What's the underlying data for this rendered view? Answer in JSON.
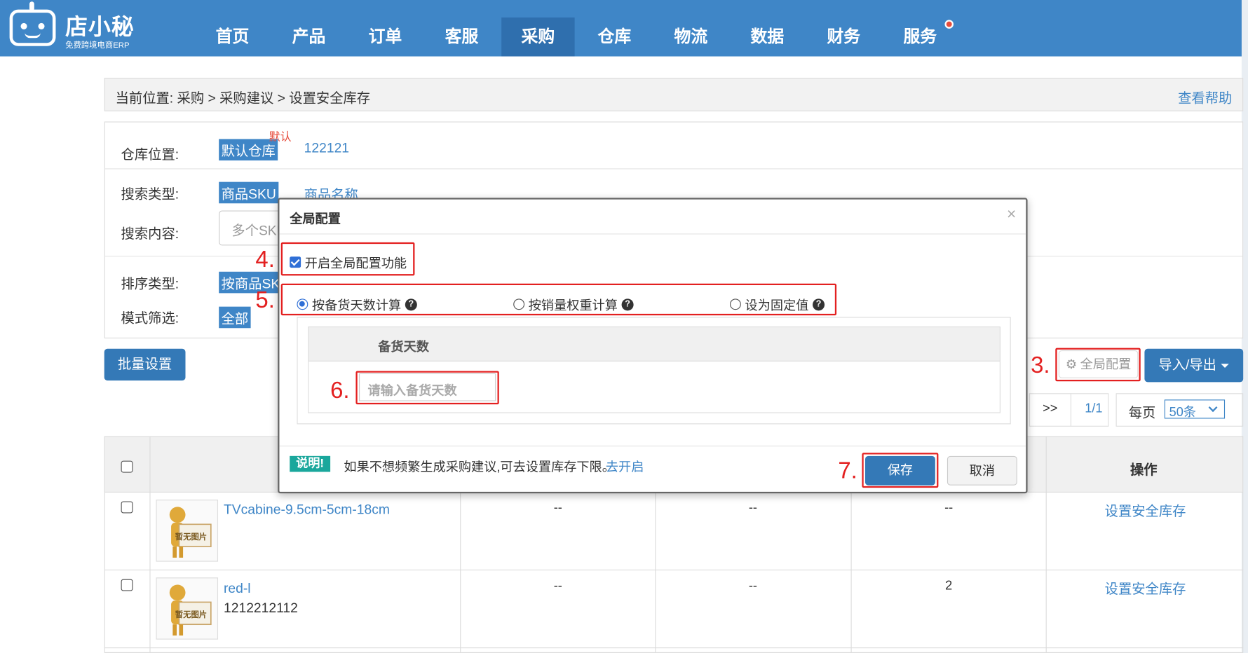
{
  "header": {
    "logo_name": "店小秘",
    "logo_sub": "免费跨境电商ERP",
    "nav": [
      {
        "label": "首页"
      },
      {
        "label": "产品"
      },
      {
        "label": "订单"
      },
      {
        "label": "客服"
      },
      {
        "label": "采购",
        "active": true
      },
      {
        "label": "仓库"
      },
      {
        "label": "物流"
      },
      {
        "label": "数据"
      },
      {
        "label": "财务"
      },
      {
        "label": "服务",
        "badge": true
      }
    ]
  },
  "breadcrumb": {
    "text": "当前位置: 采购 > 采购建议 > 设置安全库存",
    "help": "查看帮助"
  },
  "filters": {
    "warehouse_label": "仓库位置:",
    "warehouse_selected": "默认仓库",
    "warehouse_default_tag": "默认",
    "warehouse_other": "122121",
    "search_type_label": "搜索类型:",
    "search_type_selected": "商品SKU",
    "search_type_other": "商品名称",
    "search_content_label": "搜索内容:",
    "search_placeholder": "多个SKU",
    "sort_type_label": "排序类型:",
    "sort_type_selected": "按商品SKU",
    "mode_label": "模式筛选:",
    "mode_selected": "全部"
  },
  "toolbar": {
    "batch": "批量设置",
    "global_config": "全局配置",
    "import_export": "导入/导出"
  },
  "pagination": {
    "next": ">>",
    "page": "1/1",
    "per_page_label": "每页",
    "per_page_value": "50条"
  },
  "table": {
    "header_op": "操作",
    "no_image": "暂无图片",
    "rows": [
      {
        "name": "TVcabine-9.5cm-5cm-18cm",
        "sub": "",
        "c1": "--",
        "c2": "--",
        "c3": "--",
        "action": "设置安全库存"
      },
      {
        "name": "red-l",
        "sub": "1212212112",
        "c1": "--",
        "c2": "--",
        "c3": "2",
        "action": "设置安全库存"
      }
    ]
  },
  "modal": {
    "title": "全局配置",
    "close": "×",
    "enable_label": "开启全局配置功能",
    "options": [
      "按备货天数计算",
      "按销量权重计算",
      "设为固定值"
    ],
    "help_mark": "?",
    "days_header": "备货天数",
    "days_placeholder": "请输入备货天数",
    "note_badge": "说明!",
    "note_text": "如果不想频繁生成采购建议,可去设置库存下限。",
    "note_link": "去开启",
    "save": "保存",
    "cancel": "取消"
  },
  "annotations": {
    "step3": "3.",
    "step4": "4.",
    "step5": "5.",
    "step6": "6.",
    "step7": "7."
  }
}
